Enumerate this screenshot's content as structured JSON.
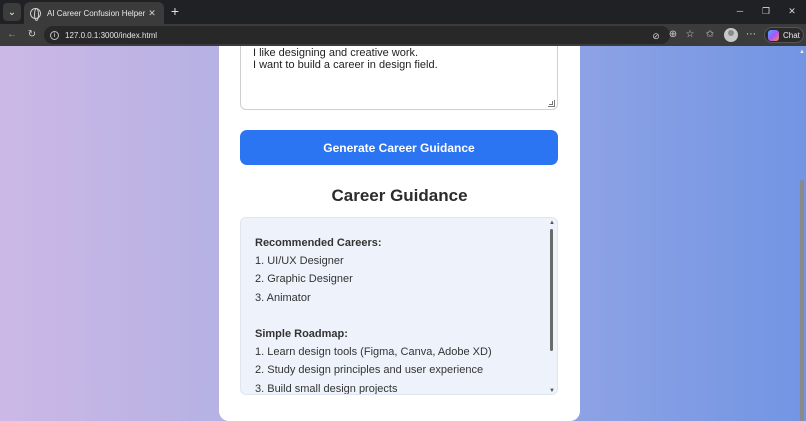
{
  "browser": {
    "tab_title": "AI Career Confusion Helper",
    "url": "127.0.0.1:3000/index.html",
    "chat_label": "Chat"
  },
  "icons": {
    "tab_list": "chevron-down-icon",
    "tab_favicon": "globe-icon",
    "tab_close": "close-icon",
    "new_tab": "plus-icon",
    "back": "back-arrow-icon",
    "reload": "reload-icon",
    "site_info": "info-icon",
    "chat": "copilot-icon"
  },
  "form": {
    "textarea_lines": [
      "I like designing and creative work.",
      "I want to build a career in design field."
    ],
    "generate_label": "Generate Career Guidance"
  },
  "result": {
    "title": "Career Guidance",
    "careers_heading": "Recommended Careers:",
    "careers": [
      "1. UI/UX Designer",
      "2. Graphic Designer",
      "3. Animator"
    ],
    "roadmap_heading": "Simple Roadmap:",
    "roadmap": [
      "1. Learn design tools (Figma, Canva, Adobe XD)",
      "2. Study design principles and user experience",
      "3. Build small design projects"
    ]
  },
  "colors": {
    "accent": "#2b75f2",
    "result_bg": "#eef3fb",
    "gradient_left": "#ccb8e6",
    "gradient_right": "#7295e4"
  }
}
